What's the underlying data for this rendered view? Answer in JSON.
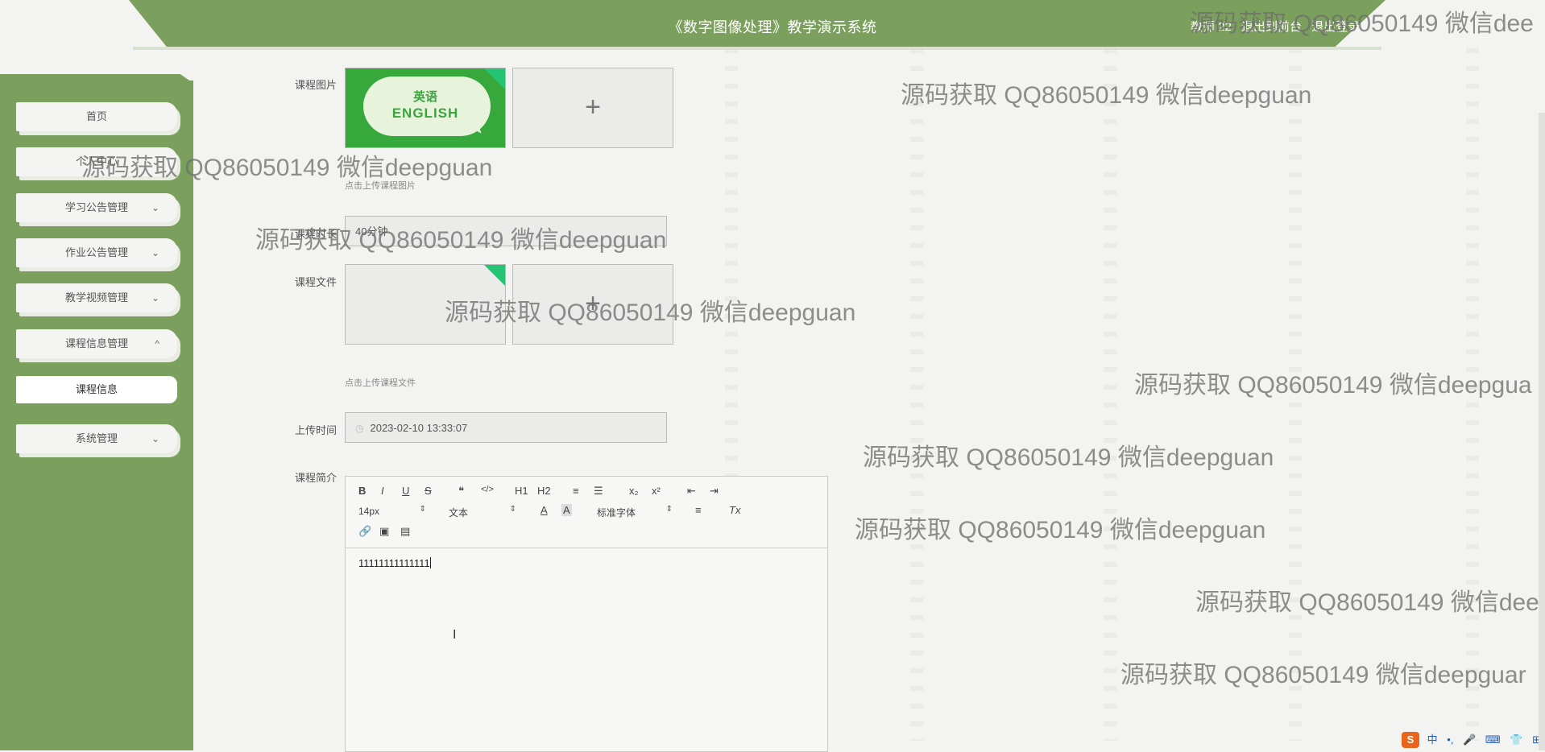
{
  "header": {
    "title": "《数字图像处理》教学演示系统",
    "user_label": "教师 22",
    "front_link": "退出到前台",
    "logout_link": "退出登录"
  },
  "sidebar": {
    "items": [
      {
        "label": "首页",
        "chevron": ""
      },
      {
        "label": "个人中心",
        "chevron": "⌄"
      },
      {
        "label": "学习公告管理",
        "chevron": "⌄"
      },
      {
        "label": "作业公告管理",
        "chevron": "⌄"
      },
      {
        "label": "教学视频管理",
        "chevron": "⌄"
      },
      {
        "label": "课程信息管理",
        "chevron": "^"
      },
      {
        "label": "课程信息",
        "chevron": ""
      },
      {
        "label": "系统管理",
        "chevron": "⌄"
      }
    ]
  },
  "form": {
    "course_image_label": "课程图片",
    "course_image_hint": "点击上传课程图片",
    "thumb_text_1": "英语",
    "thumb_text_2": "ENGLISH",
    "course_duration_label": "课程时长",
    "course_duration_value": "40分钟",
    "course_file_label": "课程文件",
    "course_file_hint": "点击上传课程文件",
    "upload_time_label": "上传时间",
    "upload_time_value": "2023-02-10 13:33:07",
    "intro_label": "课程简介",
    "plus": "+"
  },
  "editor": {
    "toolbar_row1": [
      "B",
      "I",
      "U",
      "S",
      "❝",
      "</>",
      "H1",
      "H2",
      "≡",
      "☰",
      "x₂",
      "x²",
      "⇤",
      "⇥"
    ],
    "font_size": "14px",
    "text_style": "文本",
    "font_family": "标准字体",
    "color_a": "A",
    "bg_a": "A",
    "align": "≡",
    "clear": "Tx",
    "content": "11111111111111"
  },
  "watermark": "源码获取 QQ86050149 微信deepguan",
  "watermark_clipped_1": "源码获取 QQ86050149 微信dee",
  "watermark_clipped_2": "源码获取 QQ86050149 微信deepgua",
  "watermark_clipped_3": "源码获取 QQ86050149 微信dee",
  "watermark_clipped_4": "源码获取 QQ86050149 微信deepguar",
  "ime": {
    "logo": "S",
    "mode": "中",
    "punct": "•,",
    "mic": "🎤",
    "kb": "⌨",
    "shirt": "👕",
    "grid": "⊞"
  },
  "colors": {
    "header_bg": "#7b9f5d",
    "sidebar_bg": "#7b9f5d",
    "page_bg": "#f3f3f1",
    "accent_green": "#24c474"
  }
}
